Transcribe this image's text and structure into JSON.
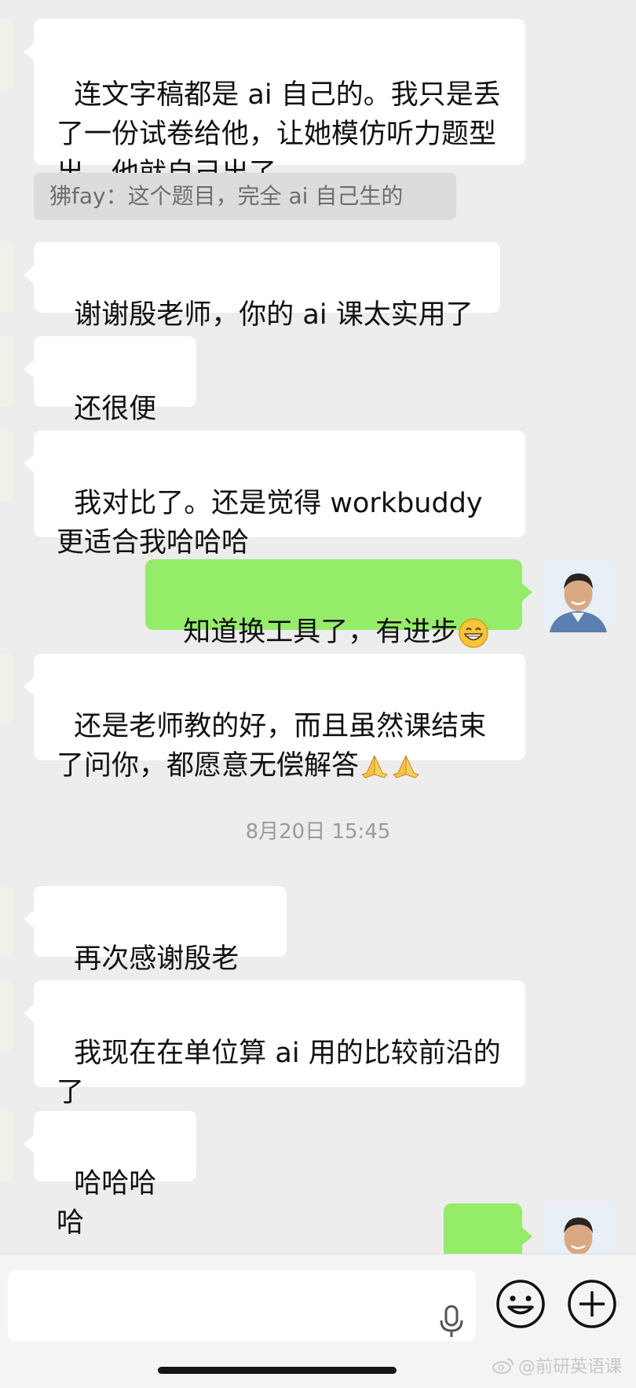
{
  "messages": [
    {
      "text": "连文字稿都是 ai 自己的。我只是丢了一份试卷给他，让她模仿听力题型出，他就自己出了"
    },
    {
      "quote": "狒fay：这个题目，完全 ai 自己生的"
    },
    {
      "text": "谢谢殷老师，你的 ai 课太实用了"
    },
    {
      "text": "还很便宜"
    },
    {
      "text": "我对比了。还是觉得 workbuddy 更适合我哈哈哈"
    },
    {
      "text": "知道换工具了，有进步"
    },
    {
      "text": "还是老师教的好，而且虽然课结束了问你，都愿意无偿解答"
    },
    {
      "timestamp": "8月20日 15:45"
    },
    {
      "text": "再次感谢殷老师"
    },
    {
      "text": "我现在在单位算 ai 用的比较前沿的了"
    },
    {
      "text": "哈哈哈哈"
    }
  ],
  "icons": {
    "grin_emoji": "grinning-face-emoji",
    "clap_emoji": "folded-hands-emoji",
    "mic": "microphone-icon",
    "emoji_button": "smiley-icon",
    "plus_button": "plus-icon"
  },
  "watermark": {
    "text": "@前研英语课"
  },
  "colors": {
    "background": "#ededed",
    "incoming_bubble": "#ffffff",
    "outgoing_bubble": "#95ec69",
    "quote": "#dcdcdc"
  }
}
